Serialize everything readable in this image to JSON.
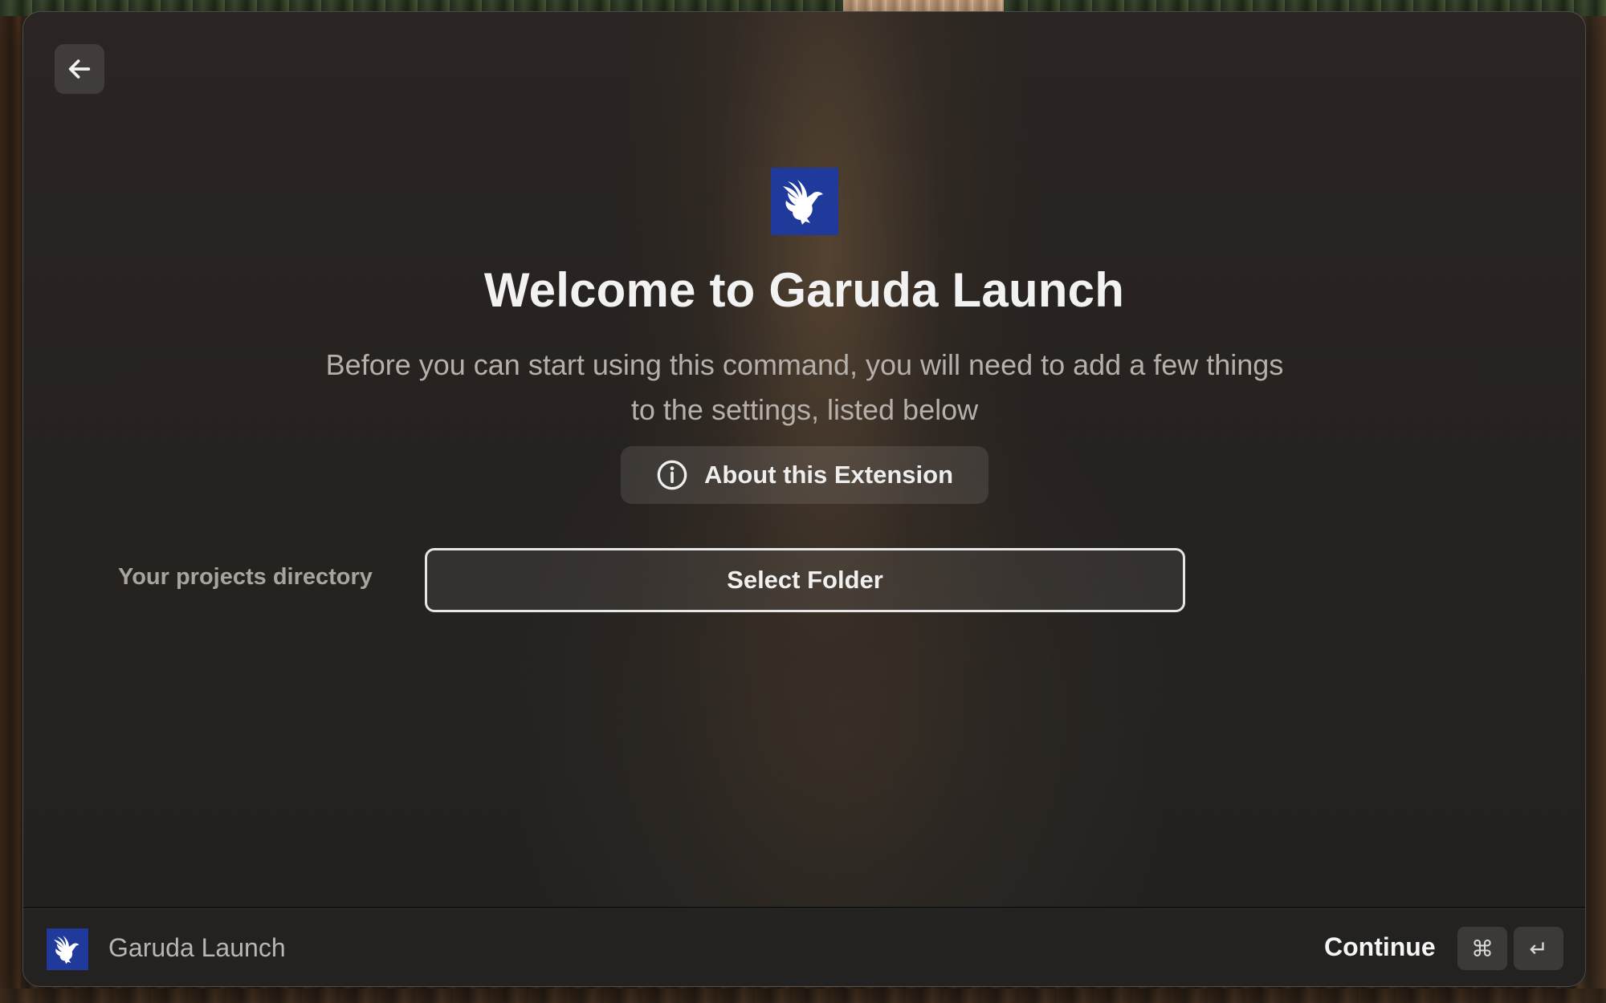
{
  "window": {
    "back_button": {
      "icon": "arrow-left-icon",
      "label": "Back"
    }
  },
  "hero": {
    "logo_icon": "garuda-logo-icon",
    "title": "Welcome to Garuda Launch",
    "subtitle": "Before you can start using this command, you will need to add a few things to the settings, listed below",
    "about_button": {
      "icon": "info-icon",
      "label": "About this Extension"
    }
  },
  "settings": {
    "fields": [
      {
        "label": "Your projects directory",
        "button_label": "Select Folder"
      }
    ]
  },
  "footer": {
    "extension_icon": "garuda-logo-icon",
    "extension_name": "Garuda Launch",
    "primary_action": "Continue",
    "shortcut_keys": [
      "⌘",
      "↵"
    ]
  },
  "colors": {
    "brand_logo_bg": "#1f3a9a",
    "title_text": "#f2f2f2",
    "subtitle_text": "#b5b0ab"
  }
}
